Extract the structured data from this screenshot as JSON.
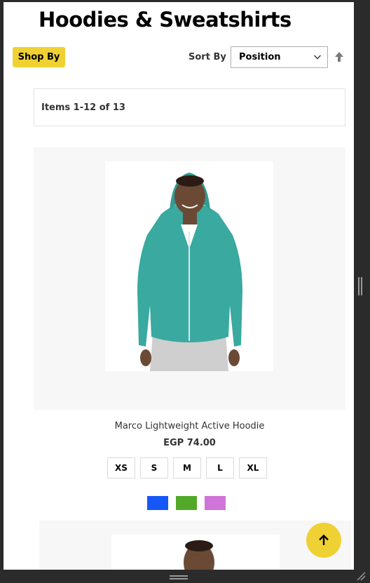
{
  "page": {
    "title": "Hoodies & Sweatshirts"
  },
  "toolbar": {
    "shop_by_label": "Shop By",
    "sort_by_label": "Sort By",
    "sort_selected": "Position",
    "amount_text": "Items 1-12 of 13",
    "sort_direction_icon": "arrow-up-icon"
  },
  "products": [
    {
      "name": "Marco Lightweight Active Hoodie",
      "price": "EGP 74.00",
      "sizes": [
        "XS",
        "S",
        "M",
        "L",
        "XL"
      ],
      "swatches": [
        {
          "label": "Blue",
          "color": "#1857f7"
        },
        {
          "label": "Green",
          "color": "#53a828"
        },
        {
          "label": "Purple",
          "color": "#d074d9"
        }
      ],
      "image_colors": {
        "hoodie": "#3aa9a0",
        "pants": "#cfcfcf",
        "skin": "#6b4a35"
      }
    },
    {
      "name": "",
      "price": ""
    }
  ],
  "colors": {
    "accent": "#f0d133",
    "page_bg": "#ffffff",
    "frame_bg": "#2b2b2b",
    "card_bg": "#f7f7f7"
  },
  "icons": {
    "chevron": "chevron-down-icon",
    "back_to_top": "arrow-up-icon"
  }
}
